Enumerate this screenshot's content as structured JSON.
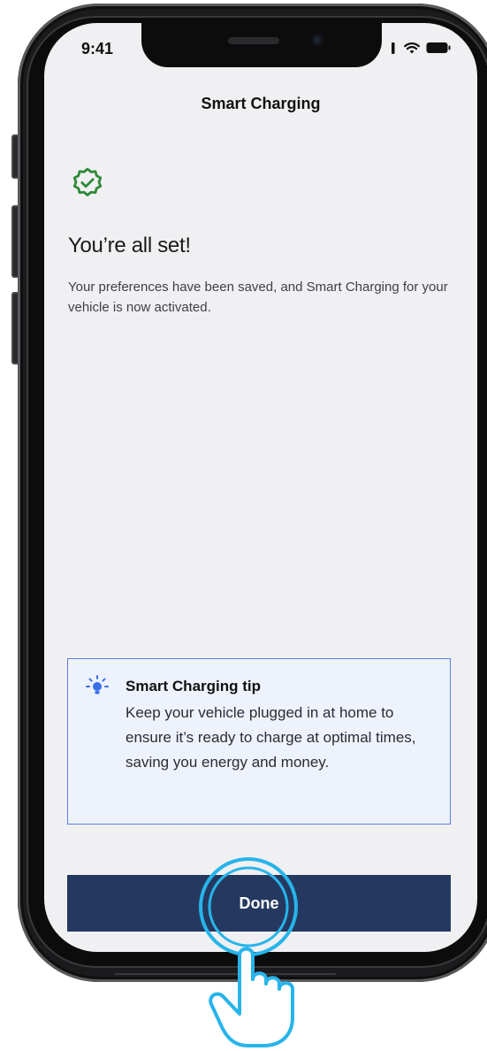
{
  "status_bar": {
    "time": "9:41",
    "icons": [
      "signal-icon",
      "wifi-icon",
      "battery-icon"
    ]
  },
  "nav": {
    "title": "Smart Charging"
  },
  "confirmation": {
    "icon": "check-badge-icon",
    "heading": "You’re all set!",
    "message": "Your preferences have been saved, and Smart Charging for your vehicle is now activated."
  },
  "tip": {
    "icon": "lightbulb-icon",
    "title": "Smart Charging tip",
    "body": "Keep your vehicle plugged in at home to ensure it’s ready to charge at optimal times, saving you energy and money."
  },
  "actions": {
    "done_label": "Done"
  },
  "tap_hint": {
    "icon": "tap-hand-icon"
  },
  "colors": {
    "screen_background": "#f0f0f2",
    "success_green": "#2f8a3a",
    "tip_background": "#eef2fd",
    "tip_border": "#5b7fe0",
    "bulb_blue": "#3b6fe8",
    "button_navy": "#253960",
    "tap_hint_cyan": "#27b4ea"
  }
}
